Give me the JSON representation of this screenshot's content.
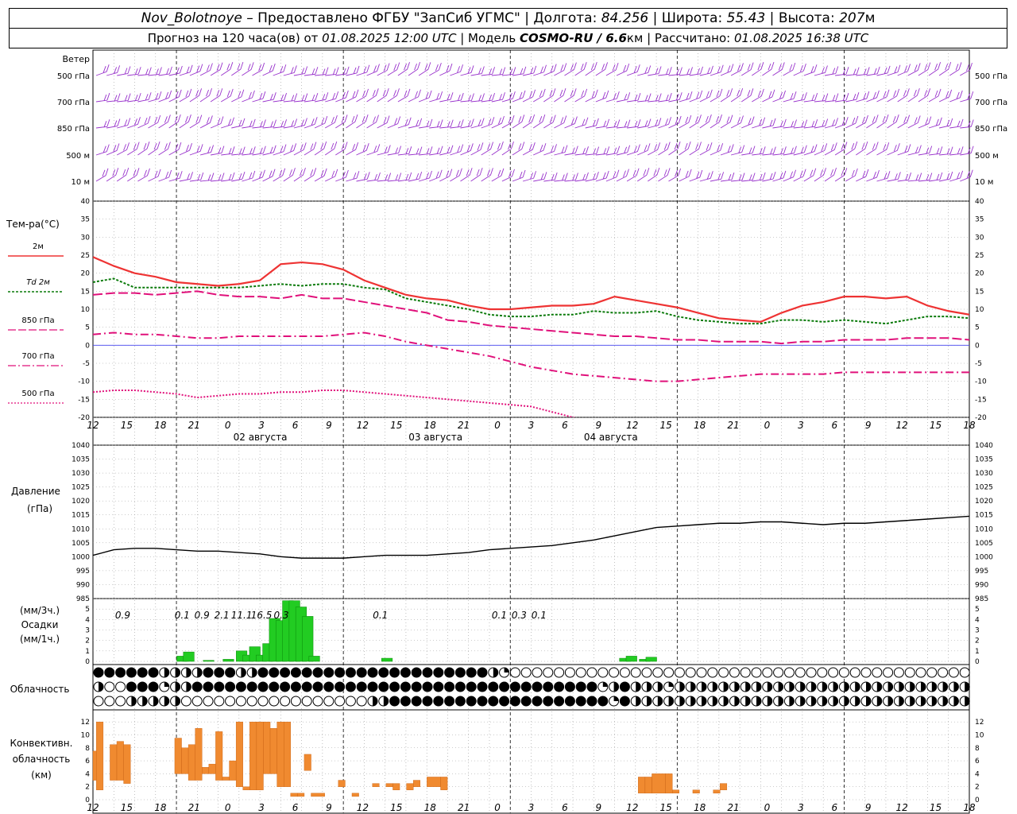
{
  "header": {
    "station": "Nov_Bolotnoye",
    "provider": " – Предоставлено ФГБУ \"ЗапСиб УГМС\" ",
    "lon_label": "| Долгота: ",
    "lon": "84.256",
    "lat_label": " | Широта: ",
    "lat": "55.43",
    "alt_label": " | Высота: ",
    "alt": "207",
    "alt_unit": "м",
    "forecast_prefix": "Прогноз на 120 часа(ов) от ",
    "forecast_start": "01.08.2025 12:00 UTC",
    "model_label": "  | Модель ",
    "model": "COSMO-RU / 6.6",
    "model_unit": "км",
    "calc_label": " | Рассчитано: ",
    "calc_time": "01.08.2025 16:38 UTC"
  },
  "labels": {
    "wind": "Ветер",
    "wind_levels": [
      "500 гПа",
      "700 гПа",
      "850 гПа",
      "500 м",
      "10  м"
    ],
    "temp": "Тем-ра(°С)",
    "temp_legend": [
      {
        "label": "2м",
        "color": "#ee3333"
      },
      {
        "label": "Td  2м",
        "color": "#0a7a0a"
      },
      {
        "label": "850 гПа",
        "color": "#e0107a"
      },
      {
        "label": "700 гПа",
        "color": "#e0107a"
      },
      {
        "label": "500 гПа",
        "color": "#e0107a"
      }
    ],
    "pressure": "Давление",
    "pressure_unit": "(гПа)",
    "precip": [
      "(мм/3ч.)",
      "Осадки",
      "(мм/1ч.)"
    ],
    "cloud": "Облачность",
    "conv": [
      "Конвективн.",
      "облачность",
      "(км)"
    ],
    "dates": [
      "02 августа",
      "03 августа",
      "04 августа"
    ]
  },
  "colors": {
    "temp2m": "#ee3333",
    "td": "#0a7a0a",
    "upper": "#e0107a",
    "wind": "#9933cc",
    "precip": "#22cc22",
    "conv": "#f08a30"
  },
  "chart_data": [
    {
      "type": "line",
      "title": "Тем-ра(°С)",
      "x_hours": [
        0,
        3,
        6,
        9,
        12,
        15,
        18,
        21,
        24,
        27,
        30,
        33,
        36,
        39,
        42,
        45,
        48,
        51,
        54,
        57,
        60,
        63,
        66,
        69,
        72,
        75,
        78,
        81,
        84,
        87,
        90,
        93,
        96,
        99,
        102,
        105,
        108,
        111,
        114,
        117,
        120,
        123,
        126
      ],
      "x_tick_labels": [
        "12",
        "15",
        "18",
        "21",
        "0",
        "3",
        "6",
        "9",
        "12",
        "15",
        "18",
        "21",
        "0",
        "3",
        "6",
        "9",
        "12",
        "15",
        "18",
        "21",
        "0",
        "3",
        "6",
        "9",
        "12",
        "15",
        "18"
      ],
      "ylim": [
        -20,
        40
      ],
      "series": [
        {
          "name": "2м",
          "values": [
            24.5,
            22,
            20,
            19,
            17.5,
            17,
            16.5,
            17,
            18,
            22.5,
            23,
            22.5,
            21,
            18,
            16,
            14,
            13,
            12.5,
            11,
            10,
            10,
            10.5,
            11,
            11,
            11.5,
            13.5,
            12.5,
            11.5,
            10.5,
            9,
            7.5,
            7,
            6.5,
            9,
            11,
            12,
            13.5,
            13.5,
            13,
            13.5,
            11,
            9.5,
            8.5
          ]
        },
        {
          "name": "Td  2м",
          "values": [
            17.5,
            18.5,
            16,
            16,
            16,
            16,
            16,
            16,
            16.5,
            17,
            16.5,
            17,
            17,
            16,
            15.5,
            13,
            12,
            11,
            10,
            8.5,
            8,
            8,
            8.5,
            8.5,
            9.5,
            9,
            9,
            9.5,
            8,
            7,
            6.5,
            6,
            6,
            7,
            7,
            6.5,
            7,
            6.5,
            6,
            7,
            8,
            8,
            7.5
          ]
        },
        {
          "name": "850 гПа",
          "values": [
            14,
            14.5,
            14.5,
            14,
            14.5,
            15,
            14,
            13.5,
            13.5,
            13,
            14,
            13,
            13,
            12,
            11,
            10,
            9,
            7,
            6.5,
            5.5,
            5,
            4.5,
            4,
            3.5,
            3,
            2.5,
            2.5,
            2,
            1.5,
            1.5,
            1,
            1,
            1,
            0.5,
            1,
            1,
            1.5,
            1.5,
            1.5,
            2,
            2,
            2,
            1.5
          ]
        },
        {
          "name": "700 гПа",
          "values": [
            3,
            3.5,
            3,
            3,
            2.5,
            2,
            2,
            2.5,
            2.5,
            2.5,
            2.5,
            2.5,
            3,
            3.5,
            2.5,
            1,
            0,
            -1,
            -2,
            -3,
            -4.5,
            -6,
            -7,
            -8,
            -8.5,
            -9,
            -9.5,
            -10,
            -10,
            -9.5,
            -9,
            -8.5,
            -8,
            -8,
            -8,
            -8,
            -7.5,
            -7.5,
            -7.5,
            -7.5,
            -7.5,
            -7.5,
            -7.5
          ]
        },
        {
          "name": "500 гПа",
          "values": [
            -13,
            -12.5,
            -12.5,
            -13,
            -13.5,
            -14.5,
            -14,
            -13.5,
            -13.5,
            -13,
            -13,
            -12.5,
            -12.5,
            -13,
            -13.5,
            -14,
            -14.5,
            -15,
            -15.5,
            -16,
            -16.5,
            -17,
            -18.5,
            -20,
            -22,
            -24,
            -26,
            -28,
            -30,
            -32,
            -34,
            -36,
            -38,
            -40,
            -42,
            -44,
            -46,
            -48,
            -50,
            -52,
            -54,
            -56,
            -58
          ]
        }
      ]
    },
    {
      "type": "line",
      "title": "Давление",
      "ylabel": "(гПа)",
      "ylim": [
        985,
        1040
      ],
      "x_hours": [
        0,
        3,
        6,
        9,
        12,
        15,
        18,
        21,
        24,
        27,
        30,
        33,
        36,
        39,
        42,
        45,
        48,
        51,
        54,
        57,
        60,
        63,
        66,
        69,
        72,
        75,
        78,
        81,
        84,
        87,
        90,
        93,
        96,
        99,
        102,
        105,
        108,
        111,
        114,
        117,
        120,
        123,
        126
      ],
      "series": [
        {
          "name": "",
          "values": [
            1000.5,
            1002.5,
            1003,
            1003,
            1002.5,
            1002,
            1002,
            1001.5,
            1001,
            1000,
            999.5,
            999.5,
            999.5,
            1000,
            1000.5,
            1000.5,
            1000.5,
            1001,
            1001.5,
            1002.5,
            1003,
            1003.5,
            1004,
            1005,
            1006,
            1007.5,
            1009,
            1010.5,
            1011,
            1011.5,
            1012,
            1012,
            1012.5,
            1012.5,
            1012,
            1011.5,
            1012,
            1012,
            1012.5,
            1013,
            1013.5,
            1014,
            1014.5
          ]
        }
      ]
    },
    {
      "type": "bar",
      "title": "Осадки",
      "ylim": [
        0,
        6
      ],
      "labels_3h": [
        {
          "hour": 4.5,
          "text": "0.9"
        },
        {
          "hour": 13.5,
          "text": "0.1"
        },
        {
          "hour": 16.5,
          "text": "0.9"
        },
        {
          "hour": 19.5,
          "text": "2.1"
        },
        {
          "hour": 22.5,
          "text": "11.1"
        },
        {
          "hour": 25.5,
          "text": "16.5"
        },
        {
          "hour": 28.5,
          "text": "0.3"
        },
        {
          "hour": 43.5,
          "text": "0.1"
        },
        {
          "hour": 61.5,
          "text": "0.1"
        },
        {
          "hour": 64.5,
          "text": "0.3"
        },
        {
          "hour": 67.5,
          "text": "0.1"
        }
      ],
      "bars_1h": [
        {
          "hour": 13.5,
          "value": 0.5
        },
        {
          "hour": 14.5,
          "value": 0.9
        },
        {
          "hour": 17.5,
          "value": 0.1
        },
        {
          "hour": 20.5,
          "value": 0.2
        },
        {
          "hour": 22.5,
          "value": 1.0
        },
        {
          "hour": 23.5,
          "value": 0.6
        },
        {
          "hour": 24.5,
          "value": 1.4
        },
        {
          "hour": 25.5,
          "value": 0.6
        },
        {
          "hour": 26.5,
          "value": 1.7
        },
        {
          "hour": 27.5,
          "value": 4.1
        },
        {
          "hour": 28.5,
          "value": 3.9
        },
        {
          "hour": 29.5,
          "value": 5.8
        },
        {
          "hour": 30.5,
          "value": 5.8
        },
        {
          "hour": 31.5,
          "value": 5.2
        },
        {
          "hour": 32.5,
          "value": 4.3
        },
        {
          "hour": 33.5,
          "value": 0.5
        },
        {
          "hour": 44.5,
          "value": 0.3
        },
        {
          "hour": 80.5,
          "value": 0.3
        },
        {
          "hour": 81.5,
          "value": 0.5
        },
        {
          "hour": 83.5,
          "value": 0.2
        },
        {
          "hour": 84.5,
          "value": 0.4
        }
      ]
    },
    {
      "type": "table",
      "title": "Облачность",
      "rows": [
        "ffffffhhhhfffhhfffffffffffffffffffffhqeeeeeeeeeeeeeeeeeeeeeeeeeeeeeeeeeeeeeeeeeeee",
        "heefffqhhfffffffffffffffffffffffffffffffffffffqhfhhhqhhhhhhhhhhhhhhhhhhhhhhhhhhhhhhhheee",
        "eeehhhhheeeeeeeeeeeeeeeeehhffffffffffffffffffffqfhhhhhhhhhhhhhhhhhhhhhhhhhhhhhhhhhhhhhhhe"
      ]
    },
    {
      "type": "bar",
      "title": "Конвективн. облачность",
      "ylabel": "(км)",
      "ylim": [
        0,
        13
      ],
      "bars": [
        {
          "h0": 0,
          "h1": 0.5,
          "base": 3,
          "top": 7.5
        },
        {
          "h0": 0.5,
          "h1": 1.5,
          "base": 1.5,
          "top": 12
        },
        {
          "h0": 2.5,
          "h1": 3.5,
          "base": 3,
          "top": 8.5
        },
        {
          "h0": 3.5,
          "h1": 4.5,
          "base": 3,
          "top": 9
        },
        {
          "h0": 4.5,
          "h1": 5.5,
          "base": 2.5,
          "top": 8.5
        },
        {
          "h0": 12,
          "h1": 13,
          "base": 4,
          "top": 9.5
        },
        {
          "h0": 13,
          "h1": 14,
          "base": 4,
          "top": 8
        },
        {
          "h0": 14,
          "h1": 15,
          "base": 3,
          "top": 8.5
        },
        {
          "h0": 15,
          "h1": 16,
          "base": 3,
          "top": 11
        },
        {
          "h0": 16,
          "h1": 17,
          "base": 4,
          "top": 5
        },
        {
          "h0": 17,
          "h1": 18,
          "base": 4,
          "top": 5.5
        },
        {
          "h0": 18,
          "h1": 19,
          "base": 3,
          "top": 10.5
        },
        {
          "h0": 19,
          "h1": 20,
          "base": 3,
          "top": 3.5
        },
        {
          "h0": 20,
          "h1": 21,
          "base": 3,
          "top": 6
        },
        {
          "h0": 21,
          "h1": 22,
          "base": 2,
          "top": 12
        },
        {
          "h0": 22,
          "h1": 23,
          "base": 1.5,
          "top": 2
        },
        {
          "h0": 23,
          "h1": 24,
          "base": 1.5,
          "top": 12
        },
        {
          "h0": 24,
          "h1": 25,
          "base": 1.5,
          "top": 12
        },
        {
          "h0": 25,
          "h1": 26,
          "base": 4,
          "top": 12
        },
        {
          "h0": 26,
          "h1": 27,
          "base": 4,
          "top": 11
        },
        {
          "h0": 27,
          "h1": 28,
          "base": 2,
          "top": 12
        },
        {
          "h0": 28,
          "h1": 29,
          "base": 2,
          "top": 12
        },
        {
          "h0": 29,
          "h1": 30,
          "base": 0.5,
          "top": 1
        },
        {
          "h0": 30,
          "h1": 31,
          "base": 0.5,
          "top": 1
        },
        {
          "h0": 31,
          "h1": 32,
          "base": 4.5,
          "top": 7
        },
        {
          "h0": 32,
          "h1": 34,
          "base": 0.5,
          "top": 1
        },
        {
          "h0": 36,
          "h1": 37,
          "base": 2,
          "top": 3
        },
        {
          "h0": 38,
          "h1": 39,
          "base": 0.5,
          "top": 1
        },
        {
          "h0": 41,
          "h1": 42,
          "base": 2,
          "top": 2.5
        },
        {
          "h0": 43,
          "h1": 44,
          "base": 2,
          "top": 2.5
        },
        {
          "h0": 44,
          "h1": 45,
          "base": 1.5,
          "top": 2.5
        },
        {
          "h0": 46,
          "h1": 47,
          "base": 1.5,
          "top": 2.5
        },
        {
          "h0": 47,
          "h1": 48,
          "base": 2,
          "top": 3
        },
        {
          "h0": 49,
          "h1": 51,
          "base": 2,
          "top": 3.5
        },
        {
          "h0": 51,
          "h1": 52,
          "base": 1.5,
          "top": 3.5
        },
        {
          "h0": 80,
          "h1": 81,
          "base": 1,
          "top": 3.5
        },
        {
          "h0": 81,
          "h1": 82,
          "base": 1,
          "top": 3.5
        },
        {
          "h0": 82,
          "h1": 84,
          "base": 1,
          "top": 4
        },
        {
          "h0": 84,
          "h1": 85,
          "base": 1,
          "top": 4
        },
        {
          "h0": 85,
          "h1": 86,
          "base": 1,
          "top": 1.5
        },
        {
          "h0": 88,
          "h1": 89,
          "base": 1,
          "top": 1.5
        },
        {
          "h0": 91,
          "h1": 92,
          "base": 1,
          "top": 1.5
        },
        {
          "h0": 92,
          "h1": 93,
          "base": 1.5,
          "top": 2.5
        }
      ]
    }
  ]
}
